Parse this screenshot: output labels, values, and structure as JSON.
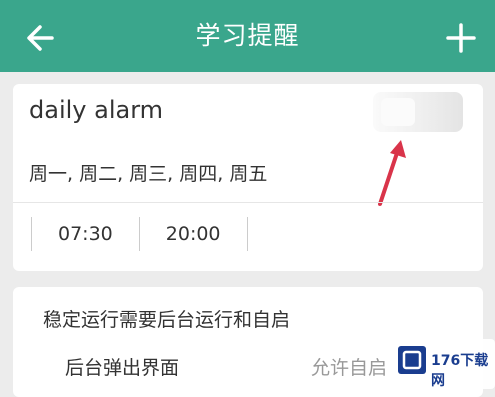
{
  "header": {
    "title": "学习提醒",
    "back_icon": "arrow-left-icon",
    "add_icon": "plus-icon",
    "color": "#3aa68c"
  },
  "alarm": {
    "name": "daily alarm",
    "days": "周一, 周二, 周三, 周四, 周五",
    "times": [
      "07:30",
      "20:00"
    ]
  },
  "background_settings": {
    "hint": "稳定运行需要后台运行和自启",
    "row_label": "后台弹出界面",
    "row_value": "允许自启"
  },
  "watermark": {
    "text": "176下载网"
  },
  "annotation_color": "#d9344a"
}
